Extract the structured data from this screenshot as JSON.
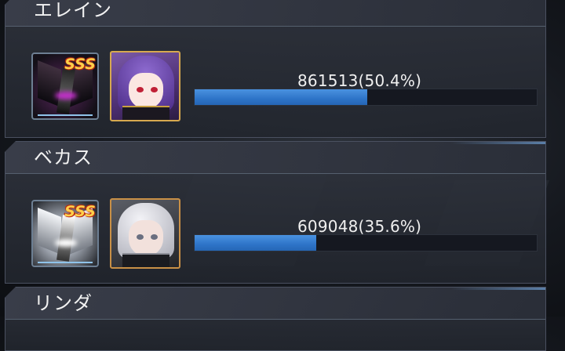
{
  "players": [
    {
      "name": "エレイン",
      "mech_rank": "SSS",
      "score_text": "861513(50.4%)",
      "percent": 50.4,
      "mech_style": "dark",
      "char_style": "purple"
    },
    {
      "name": "ベカス",
      "mech_rank": "SSS",
      "score_text": "609048(35.6%)",
      "percent": 35.6,
      "mech_style": "light",
      "char_style": "silver"
    },
    {
      "name": "リンダ"
    }
  ],
  "colors": {
    "bar_fill": "#2e74c8",
    "bar_track": "#151820",
    "rank_text": "#ffd04a",
    "panel": "#30343e"
  },
  "icons": [
    "mech-portrait-icon",
    "character-portrait-icon",
    "sss-rank-badge-icon"
  ]
}
